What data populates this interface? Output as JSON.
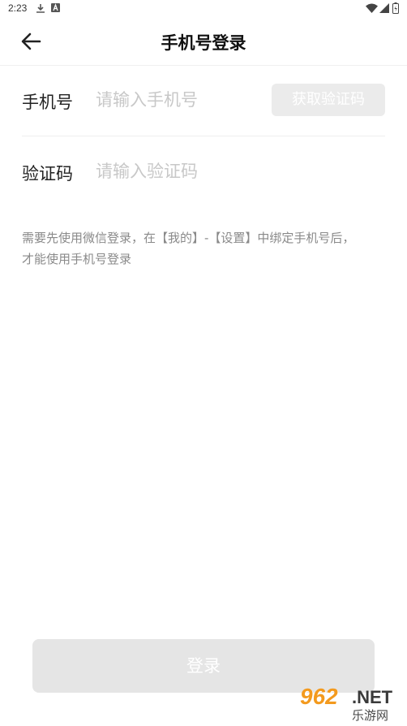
{
  "status_bar": {
    "time": "2:23",
    "icons": [
      "download-icon",
      "notification-a-icon",
      "wifi-icon",
      "signal-icon",
      "battery-icon"
    ]
  },
  "nav": {
    "title": "手机号登录",
    "back_icon": "back-arrow-icon"
  },
  "form": {
    "phone_label": "手机号",
    "phone_placeholder": "请输入手机号",
    "phone_value": "",
    "get_code_label": "获取验证码",
    "code_label": "验证码",
    "code_placeholder": "请输入验证码",
    "code_value": ""
  },
  "hint": {
    "line1": "需要先使用微信登录，在【我的】-【设置】中绑定手机号后，",
    "line2": "才能使用手机号登录"
  },
  "login_button": {
    "label": "登录"
  },
  "watermark": {
    "number": "962",
    "net": ".NET",
    "subtitle": "乐游网"
  },
  "colors": {
    "background": "#ffffff",
    "disabled_button_bg": "#ebebeb",
    "placeholder": "#c8c8c8",
    "hint_text": "#8a8a8a",
    "watermark_accent": "#f39a1e"
  }
}
